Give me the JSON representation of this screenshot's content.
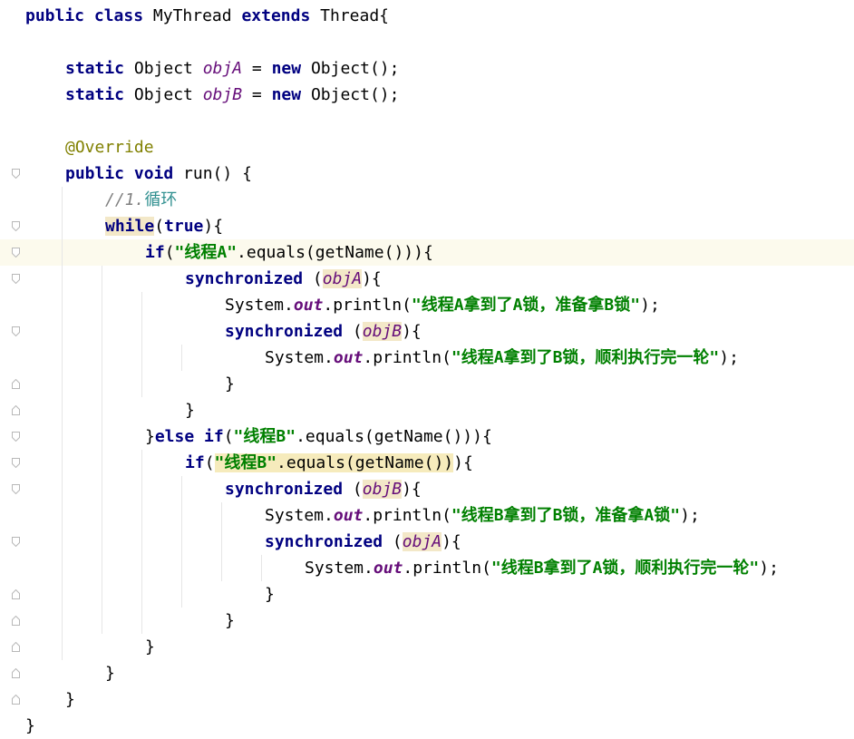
{
  "editor": {
    "lines": [
      {
        "n": 1,
        "indent": 0,
        "tokens": [
          {
            "t": "public class ",
            "c": "kw"
          },
          {
            "t": "MyThread ",
            "c": ""
          },
          {
            "t": "extends ",
            "c": "kw"
          },
          {
            "t": "Thread{",
            "c": ""
          }
        ]
      },
      {
        "n": 2,
        "indent": 0,
        "tokens": []
      },
      {
        "n": 3,
        "indent": 1,
        "tokens": [
          {
            "t": "static ",
            "c": "kw"
          },
          {
            "t": "Object ",
            "c": ""
          },
          {
            "t": "objA",
            "c": "fld"
          },
          {
            "t": " = ",
            "c": ""
          },
          {
            "t": "new ",
            "c": "kw"
          },
          {
            "t": "Object();",
            "c": ""
          }
        ]
      },
      {
        "n": 4,
        "indent": 1,
        "tokens": [
          {
            "t": "static ",
            "c": "kw"
          },
          {
            "t": "Object ",
            "c": ""
          },
          {
            "t": "objB",
            "c": "fld"
          },
          {
            "t": " = ",
            "c": ""
          },
          {
            "t": "new ",
            "c": "kw"
          },
          {
            "t": "Object();",
            "c": ""
          }
        ]
      },
      {
        "n": 5,
        "indent": 0,
        "tokens": []
      },
      {
        "n": 6,
        "indent": 1,
        "tokens": [
          {
            "t": "@Override",
            "c": "ann"
          }
        ]
      },
      {
        "n": 7,
        "indent": 1,
        "tokens": [
          {
            "t": "public void ",
            "c": "kw"
          },
          {
            "t": "run() {",
            "c": ""
          }
        ]
      },
      {
        "n": 8,
        "indent": 2,
        "tokens": [
          {
            "t": "//1.",
            "c": "cmt"
          },
          {
            "t": "循环",
            "c": "cmt-zh"
          }
        ]
      },
      {
        "n": 9,
        "indent": 2,
        "tokens": [
          {
            "t": "while",
            "c": "kw hl2"
          },
          {
            "t": "(",
            "c": ""
          },
          {
            "t": "true",
            "c": "kw"
          },
          {
            "t": "){",
            "c": ""
          }
        ]
      },
      {
        "n": 10,
        "indent": 3,
        "current": true,
        "tokens": [
          {
            "t": "if",
            "c": "kw"
          },
          {
            "t": "(",
            "c": ""
          },
          {
            "t": "\"线程A\"",
            "c": "str"
          },
          {
            "t": ".equals(getName())){",
            "c": ""
          }
        ]
      },
      {
        "n": 11,
        "indent": 4,
        "tokens": [
          {
            "t": "synchronized ",
            "c": "kw"
          },
          {
            "t": "(",
            "c": ""
          },
          {
            "t": "objA",
            "c": "fld hl2"
          },
          {
            "t": "){",
            "c": ""
          }
        ]
      },
      {
        "n": 12,
        "indent": 5,
        "tokens": [
          {
            "t": "System.",
            "c": ""
          },
          {
            "t": "out",
            "c": "sfld"
          },
          {
            "t": ".println(",
            "c": ""
          },
          {
            "t": "\"线程A拿到了A锁，准备拿B锁\"",
            "c": "str"
          },
          {
            "t": ");",
            "c": ""
          }
        ]
      },
      {
        "n": 13,
        "indent": 5,
        "tokens": [
          {
            "t": "synchronized ",
            "c": "kw"
          },
          {
            "t": "(",
            "c": ""
          },
          {
            "t": "objB",
            "c": "fld hl2"
          },
          {
            "t": "){",
            "c": ""
          }
        ]
      },
      {
        "n": 14,
        "indent": 6,
        "tokens": [
          {
            "t": "System.",
            "c": ""
          },
          {
            "t": "out",
            "c": "sfld"
          },
          {
            "t": ".println(",
            "c": ""
          },
          {
            "t": "\"线程A拿到了B锁，顺利执行完一轮\"",
            "c": "str"
          },
          {
            "t": ");",
            "c": ""
          }
        ]
      },
      {
        "n": 15,
        "indent": 5,
        "tokens": [
          {
            "t": "}",
            "c": ""
          }
        ]
      },
      {
        "n": 16,
        "indent": 4,
        "tokens": [
          {
            "t": "}",
            "c": ""
          }
        ]
      },
      {
        "n": 17,
        "indent": 3,
        "tokens": [
          {
            "t": "}",
            "c": ""
          },
          {
            "t": "else if",
            "c": "kw"
          },
          {
            "t": "(",
            "c": ""
          },
          {
            "t": "\"线程B\"",
            "c": "str"
          },
          {
            "t": ".equals(getName())){",
            "c": ""
          }
        ]
      },
      {
        "n": 18,
        "indent": 4,
        "tokens": [
          {
            "t": "if",
            "c": "kw"
          },
          {
            "t": "(",
            "c": ""
          },
          {
            "t": "\"线程B\"",
            "c": "str hl"
          },
          {
            "t": ".equals(getName())",
            "c": "hl"
          },
          {
            "t": "){",
            "c": ""
          }
        ]
      },
      {
        "n": 19,
        "indent": 5,
        "tokens": [
          {
            "t": "synchronized ",
            "c": "kw"
          },
          {
            "t": "(",
            "c": ""
          },
          {
            "t": "objB",
            "c": "fld hl2"
          },
          {
            "t": "){",
            "c": ""
          }
        ]
      },
      {
        "n": 20,
        "indent": 6,
        "tokens": [
          {
            "t": "System.",
            "c": ""
          },
          {
            "t": "out",
            "c": "sfld"
          },
          {
            "t": ".println(",
            "c": ""
          },
          {
            "t": "\"线程B拿到了B锁，准备拿A锁\"",
            "c": "str"
          },
          {
            "t": ");",
            "c": ""
          }
        ]
      },
      {
        "n": 21,
        "indent": 6,
        "tokens": [
          {
            "t": "synchronized ",
            "c": "kw"
          },
          {
            "t": "(",
            "c": ""
          },
          {
            "t": "objA",
            "c": "fld hl2"
          },
          {
            "t": "){",
            "c": ""
          }
        ]
      },
      {
        "n": 22,
        "indent": 7,
        "tokens": [
          {
            "t": "System.",
            "c": ""
          },
          {
            "t": "out",
            "c": "sfld"
          },
          {
            "t": ".println(",
            "c": ""
          },
          {
            "t": "\"线程B拿到了A锁，顺利执行完一轮\"",
            "c": "str"
          },
          {
            "t": ");",
            "c": ""
          }
        ]
      },
      {
        "n": 23,
        "indent": 6,
        "tokens": [
          {
            "t": "}",
            "c": ""
          }
        ]
      },
      {
        "n": 24,
        "indent": 5,
        "tokens": [
          {
            "t": "}",
            "c": ""
          }
        ]
      },
      {
        "n": 25,
        "indent": 3,
        "tokens": [
          {
            "t": "}",
            "c": ""
          }
        ]
      },
      {
        "n": 26,
        "indent": 2,
        "tokens": [
          {
            "t": "}",
            "c": ""
          }
        ]
      },
      {
        "n": 27,
        "indent": 1,
        "tokens": [
          {
            "t": "}",
            "c": ""
          }
        ]
      },
      {
        "n": 28,
        "indent": 0,
        "tokens": [
          {
            "t": "}",
            "c": ""
          }
        ]
      }
    ],
    "fold_markers": [
      {
        "line": 7,
        "kind": "open"
      },
      {
        "line": 9,
        "kind": "open"
      },
      {
        "line": 10,
        "kind": "open"
      },
      {
        "line": 11,
        "kind": "open"
      },
      {
        "line": 13,
        "kind": "open"
      },
      {
        "line": 15,
        "kind": "close"
      },
      {
        "line": 16,
        "kind": "close"
      },
      {
        "line": 17,
        "kind": "open"
      },
      {
        "line": 18,
        "kind": "open"
      },
      {
        "line": 19,
        "kind": "open"
      },
      {
        "line": 21,
        "kind": "open"
      },
      {
        "line": 23,
        "kind": "close"
      },
      {
        "line": 24,
        "kind": "close"
      },
      {
        "line": 25,
        "kind": "close"
      },
      {
        "line": 26,
        "kind": "close"
      },
      {
        "line": 27,
        "kind": "close"
      }
    ],
    "colors": {
      "keyword": "#000080",
      "string": "#008000",
      "field": "#660e7a",
      "annotation": "#808000",
      "comment": "#808080",
      "current_line": "#fcfaed",
      "highlight": "#f6ebbc"
    }
  }
}
